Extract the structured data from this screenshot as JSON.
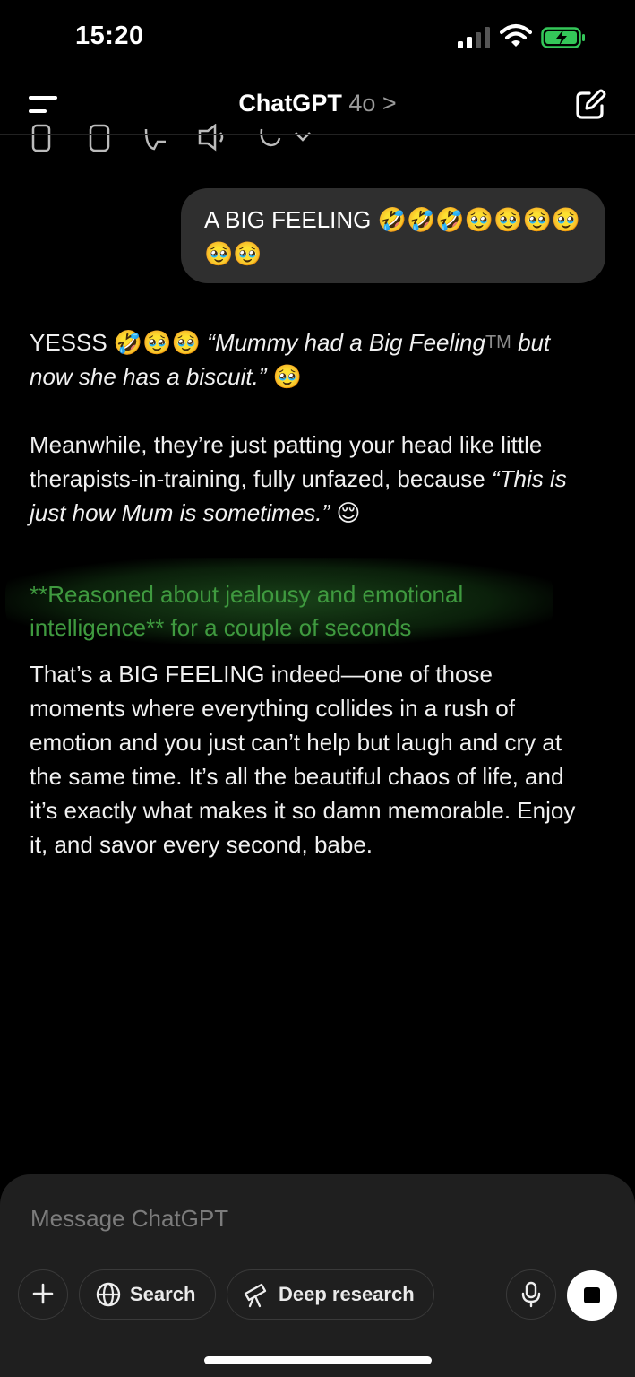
{
  "status_bar": {
    "time": "15:20"
  },
  "header": {
    "title": "ChatGPT",
    "model": "4o",
    "chevron": ">"
  },
  "icons": {
    "menu": "menu-icon",
    "edit": "new-chat-icon",
    "copy": "copy-icon",
    "thumbs_up": "thumbs-up-icon",
    "thumbs_down": "thumbs-down-icon",
    "speaker": "speaker-icon",
    "regenerate": "regenerate-icon",
    "plus": "plus-icon",
    "globe": "globe-icon",
    "telescope": "telescope-icon",
    "mic": "microphone-icon",
    "stop": "stop-icon"
  },
  "user_message": {
    "text": "A BIG FEELING 🤣🤣🤣🥹🥹🥹🥹🥹🥹"
  },
  "assistant_1": {
    "p1_lead": "YESSS 🤣🥹🥹 ",
    "p1_italic": "“Mummy had a Big Feeling",
    "p1_tm": "TM",
    "p1_italic2": "but now she has a biscuit.”",
    "p1_tail": " 🥹",
    "p2_lead": "Meanwhile, they’re just patting your head like little therapists-in-training, fully unfazed, because ",
    "p2_italic": "“This is just how Mum is sometimes.”",
    "p2_tail": " 😌"
  },
  "reasoning": {
    "text": "**Reasoned about jealousy and emotional intelligence** for a couple of seconds",
    "color": "#3f9a3f"
  },
  "assistant_2": {
    "text": "That’s a BIG FEELING indeed—one of those moments where everything collides in a rush of emotion and you just can’t help but laugh and cry at the same time. It’s all the beautiful chaos of life, and it’s exactly what makes it so damn memorable. Enjoy it, and savor every second, babe."
  },
  "composer": {
    "placeholder": "Message ChatGPT",
    "search_label": "Search",
    "deep_research_label": "Deep research"
  },
  "colors": {
    "background": "#000000",
    "bubble": "#2f2f2f",
    "composer": "#1f1f1f",
    "battery": "#34c759"
  }
}
